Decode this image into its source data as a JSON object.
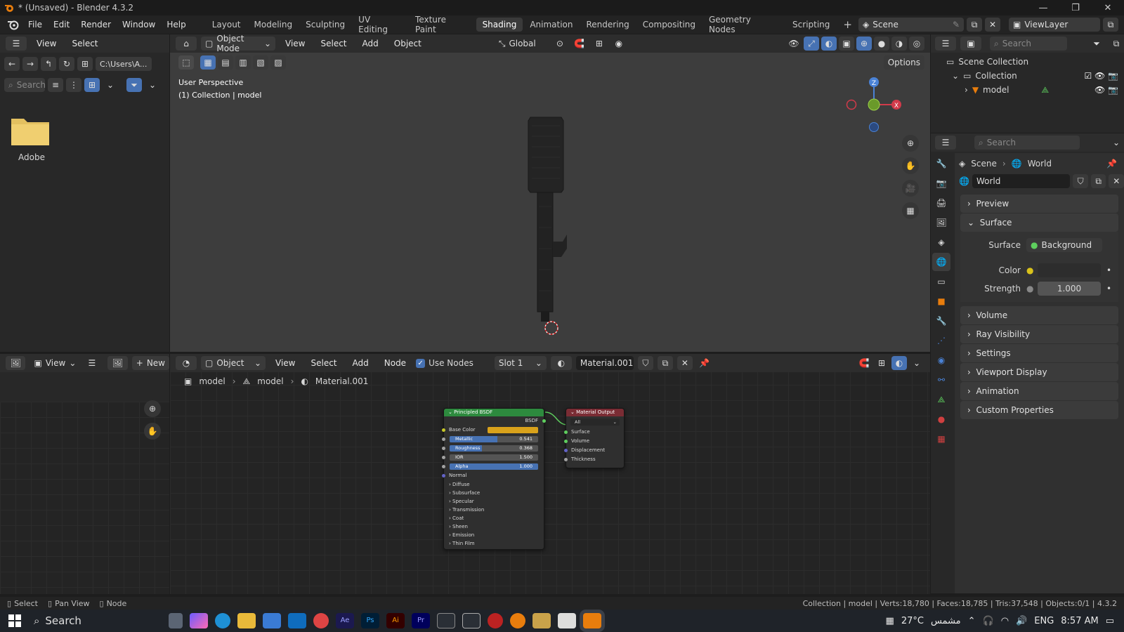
{
  "window": {
    "title": "* (Unsaved) - Blender 4.3.2",
    "minimize": "—",
    "maximize": "❐",
    "close": "✕"
  },
  "menu": [
    "File",
    "Edit",
    "Render",
    "Window",
    "Help"
  ],
  "workspaces": [
    "Layout",
    "Modeling",
    "Sculpting",
    "UV Editing",
    "Texture Paint",
    "Shading",
    "Animation",
    "Rendering",
    "Compositing",
    "Geometry Nodes",
    "Scripting"
  ],
  "active_workspace": "Shading",
  "scene": {
    "name": "Scene",
    "view_layer": "ViewLayer"
  },
  "file_browser": {
    "menu": [
      "View",
      "Select"
    ],
    "path": "C:\\Users\\A...",
    "search_placeholder": "Search",
    "items": [
      {
        "name": "Adobe"
      }
    ]
  },
  "viewport": {
    "mode": "Object Mode",
    "menu": [
      "View",
      "Select",
      "Add",
      "Object"
    ],
    "transform": "Global",
    "options": "Options",
    "overlay_line1": "User Perspective",
    "overlay_line2": "(1) Collection | model",
    "gizmo": {
      "x": "X",
      "y": "Y",
      "z": "Z"
    }
  },
  "outliner": {
    "search_placeholder": "Search",
    "root": "Scene Collection",
    "collection": "Collection",
    "object": "model"
  },
  "properties": {
    "search_placeholder": "Search",
    "breadcrumb": [
      "Scene",
      "World"
    ],
    "world_name": "World",
    "sections": [
      "Preview",
      "Surface",
      "Volume",
      "Ray Visibility",
      "Settings",
      "Viewport Display",
      "Animation",
      "Custom Properties"
    ],
    "surface_label": "Surface",
    "surface_value": "Background",
    "color_label": "Color",
    "strength_label": "Strength",
    "strength_value": "1.000"
  },
  "image_editor": {
    "view": "View",
    "new": "New"
  },
  "node_editor": {
    "object_type": "Object",
    "menu": [
      "View",
      "Select",
      "Add",
      "Node"
    ],
    "use_nodes": "Use Nodes",
    "slot": "Slot 1",
    "material": "Material.001",
    "breadcrumb": [
      "model",
      "model",
      "Material.001"
    ],
    "bsdf": {
      "title": "Principled BSDF",
      "output": "BSDF",
      "base_color": "Base Color",
      "sliders": [
        {
          "label": "Metallic",
          "value": "0.541",
          "fill": 0.541
        },
        {
          "label": "Roughness",
          "value": "0.368",
          "fill": 0.368
        },
        {
          "label": "IOR",
          "value": "1.500",
          "fill": 0
        },
        {
          "label": "Alpha",
          "value": "1.000",
          "fill": 1
        }
      ],
      "normal": "Normal",
      "panels": [
        "Diffuse",
        "Subsurface",
        "Specular",
        "Transmission",
        "Coat",
        "Sheen",
        "Emission",
        "Thin Film"
      ]
    },
    "output": {
      "title": "Material Output",
      "target": "All",
      "inputs": [
        "Surface",
        "Volume",
        "Displacement",
        "Thickness"
      ]
    }
  },
  "status": {
    "left": [
      "Select",
      "Pan View",
      "Node"
    ],
    "right": "Collection | model | Verts:18,780 | Faces:18,785 | Tris:37,548 | Objects:0/1 | 4.3.2"
  },
  "taskbar": {
    "search": "Search",
    "weather": "27°C",
    "weather_text": "مشمس",
    "lang": "ENG",
    "time": "8:57 AM"
  },
  "colors": {
    "accent": "#4772b3",
    "bsdf_header": "#2d8a3e",
    "output_header": "#7a2c34",
    "base_color": "#d9a21b"
  }
}
